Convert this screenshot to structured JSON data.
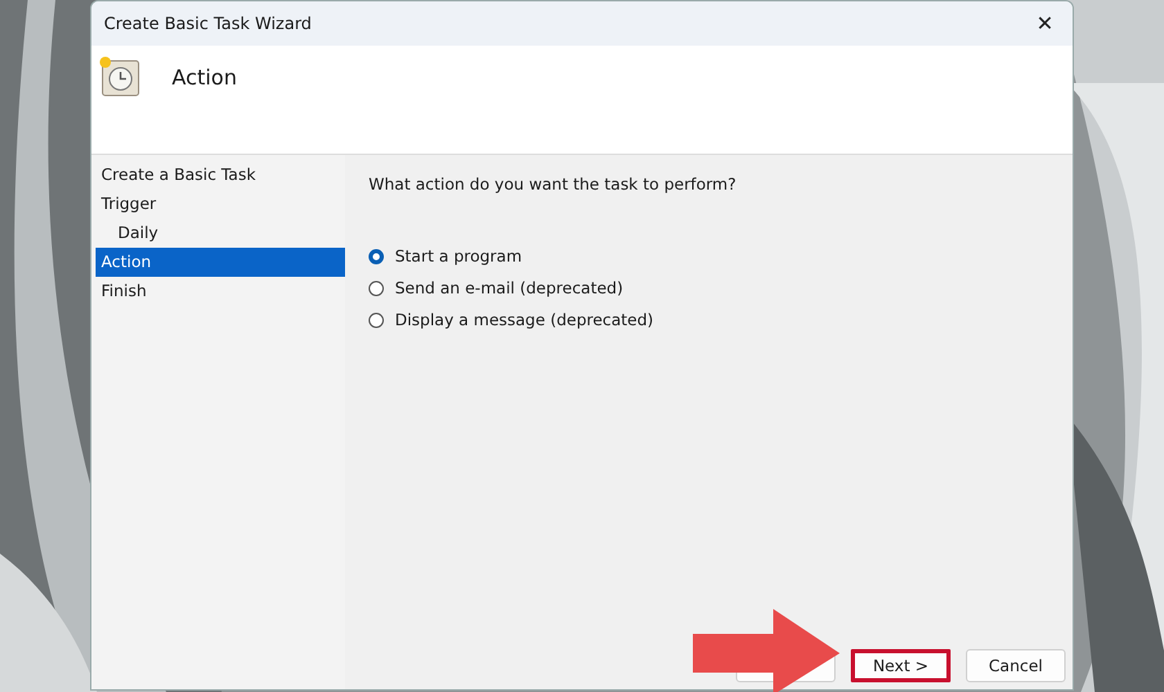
{
  "window": {
    "title": "Create Basic Task Wizard",
    "close": "✕"
  },
  "header": {
    "title": "Action"
  },
  "steps": [
    {
      "label": "Create a Basic Task",
      "selected": false
    },
    {
      "label": "Trigger",
      "selected": false,
      "children": [
        {
          "label": "Daily",
          "selected": false
        }
      ]
    },
    {
      "label": "Action",
      "selected": true
    },
    {
      "label": "Finish",
      "selected": false
    }
  ],
  "question": "What action do you want the task to perform?",
  "options": [
    {
      "label": "Start a program",
      "selected": true
    },
    {
      "label": "Send an e-mail (deprecated)",
      "selected": false
    },
    {
      "label": "Display a message (deprecated)",
      "selected": false
    }
  ],
  "buttons": [
    {
      "kind": "back"
    },
    {
      "kind": "next",
      "label": "Next >",
      "highlighted": true
    },
    {
      "kind": "cancel",
      "label": "Cancel",
      "highlighted": false
    }
  ]
}
